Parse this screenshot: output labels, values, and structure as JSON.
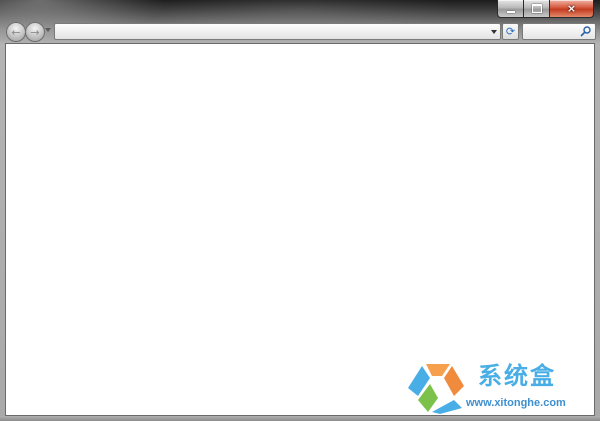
{
  "window": {
    "caption": {
      "minimize_icon": "minimize-icon",
      "maximize_icon": "maximize-icon",
      "close_icon": "close-icon",
      "close_glyph": "×",
      "close_color": "#c23b20"
    }
  },
  "nav": {
    "back_icon": "back-arrow-icon",
    "forward_icon": "forward-arrow-icon",
    "back_glyph": "←",
    "forward_glyph": "→",
    "address": {
      "value": "",
      "placeholder": ""
    },
    "refresh_glyph": "⟳",
    "search": {
      "value": "",
      "placeholder": ""
    }
  },
  "watermark": {
    "title": "系统盒",
    "url": "www.xitonghe.com",
    "colors": {
      "blue": "#4aaee6",
      "orange": "#f6a04d",
      "green": "#7cc24a"
    }
  }
}
